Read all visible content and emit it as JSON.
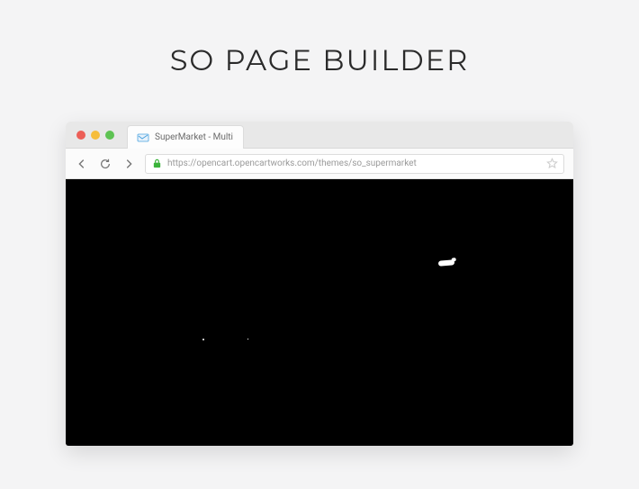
{
  "page": {
    "title": "SO PAGE BUILDER"
  },
  "browser": {
    "tab": {
      "title": "SuperMarket - Multi",
      "favicon_color": "#4aa3df"
    },
    "url": "https://opencart.opencartworks.com/themes/so_supermarket"
  }
}
